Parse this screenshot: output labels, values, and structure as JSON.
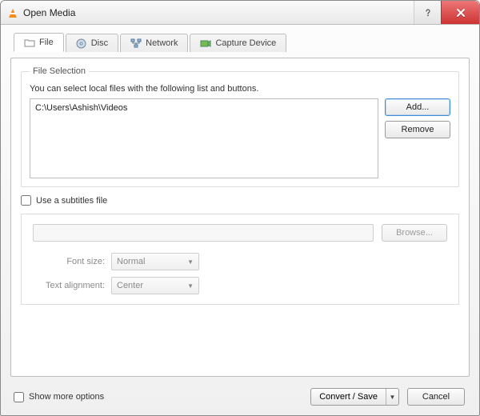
{
  "window": {
    "title": "Open Media"
  },
  "tabs": {
    "file": {
      "label": "File"
    },
    "disc": {
      "label": "Disc"
    },
    "network": {
      "label": "Network"
    },
    "capture": {
      "label": "Capture Device"
    }
  },
  "fileSelection": {
    "legend": "File Selection",
    "hint": "You can select local files with the following list and buttons.",
    "items": [
      "C:\\Users\\Ashish\\Videos"
    ],
    "addLabel": "Add...",
    "removeLabel": "Remove"
  },
  "subtitles": {
    "checkboxLabel": "Use a subtitles file",
    "browseLabel": "Browse...",
    "fontSizeLabel": "Font size:",
    "fontSizeValue": "Normal",
    "alignLabel": "Text alignment:",
    "alignValue": "Center"
  },
  "footer": {
    "showMoreLabel": "Show more options",
    "convertLabel": "Convert / Save",
    "cancelLabel": "Cancel"
  }
}
